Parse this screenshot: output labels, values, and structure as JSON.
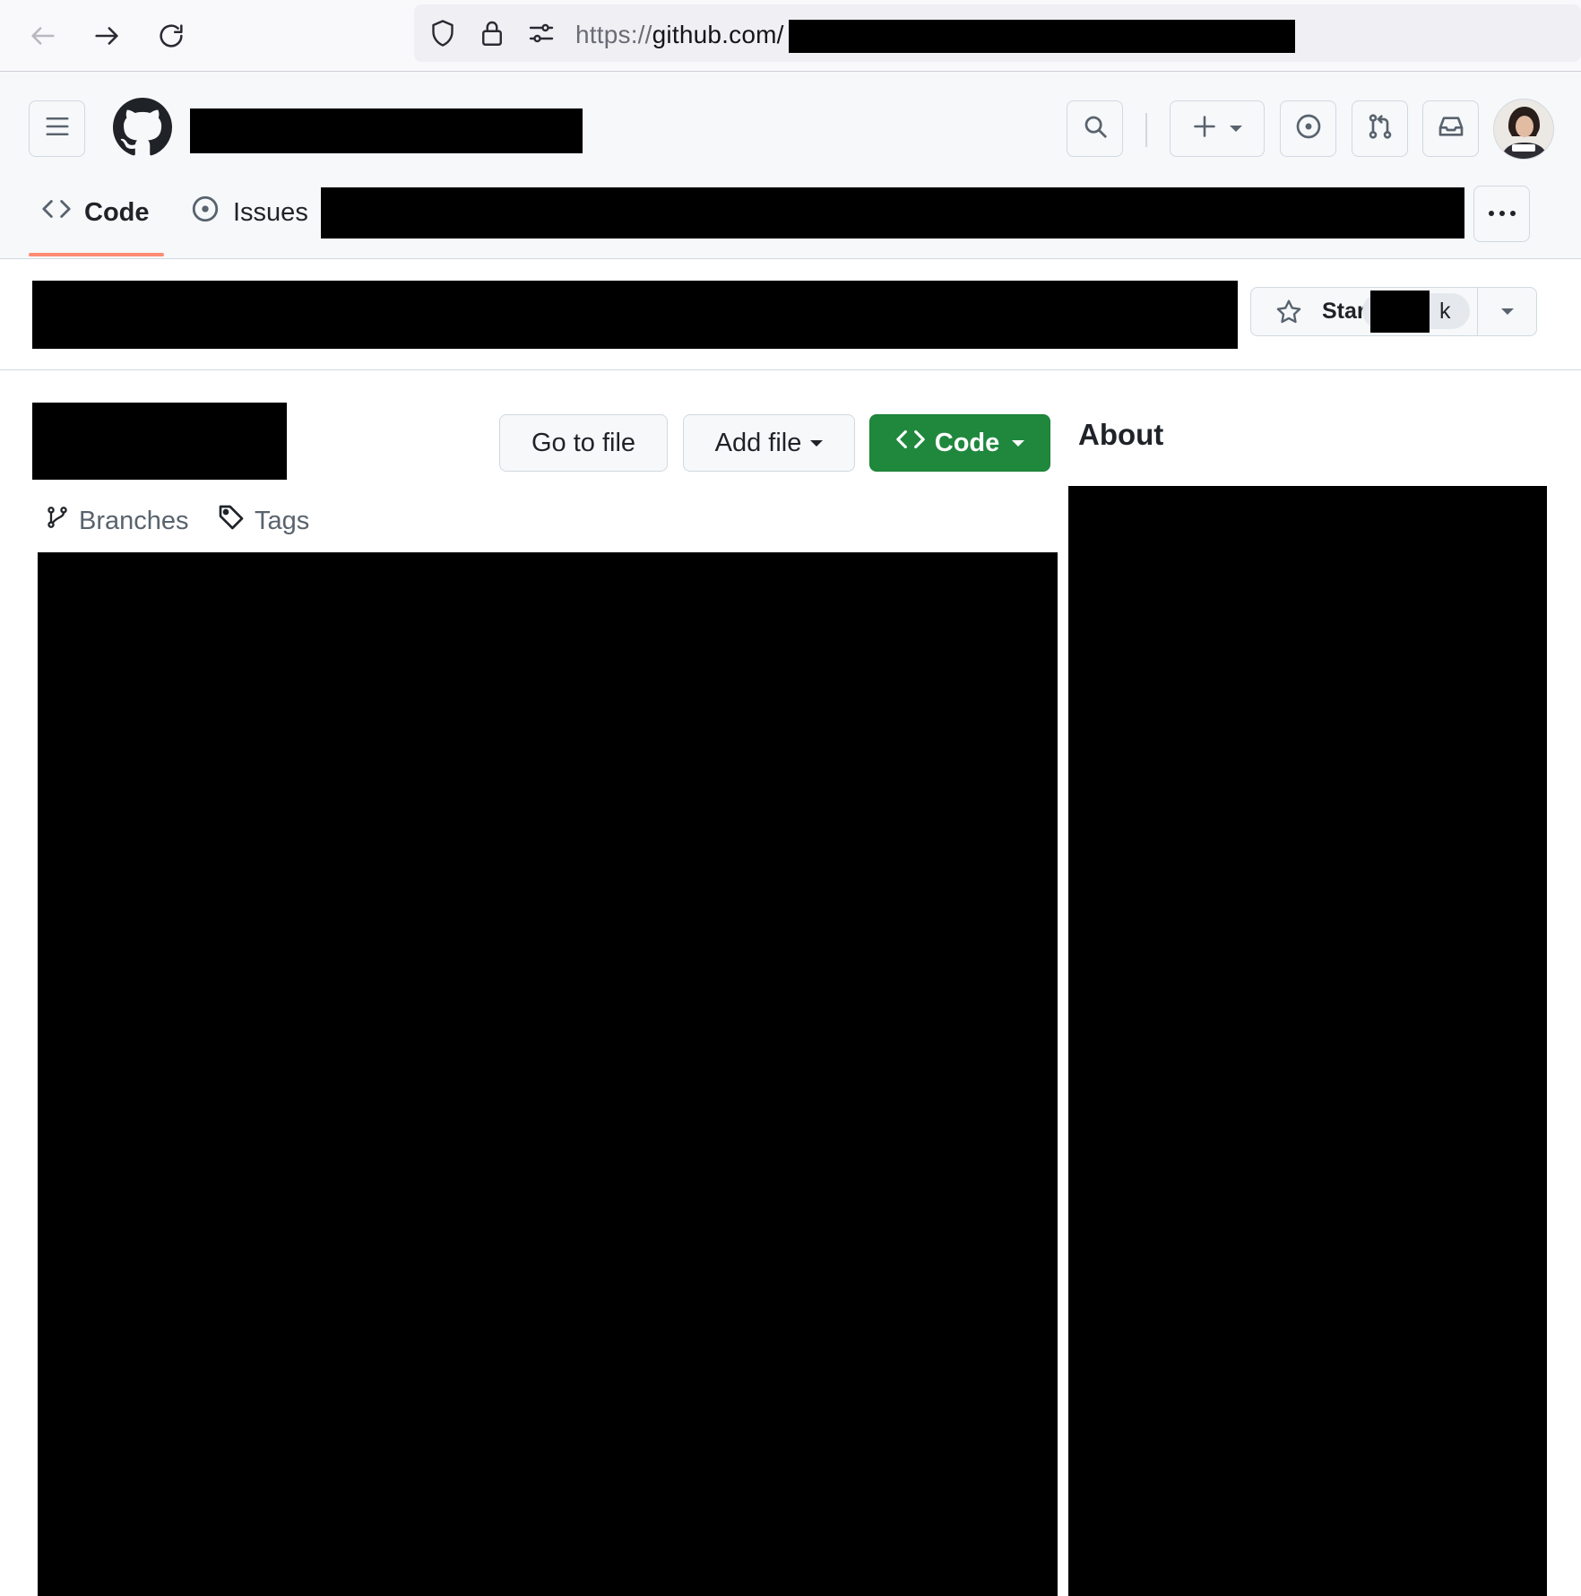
{
  "browser": {
    "url_scheme": "https://",
    "url_host": "github.com/",
    "icons": [
      "back-arrow-icon",
      "forward-arrow-icon",
      "reload-icon",
      "shield-icon",
      "lock-icon",
      "permissions-icon"
    ]
  },
  "header": {
    "icons": [
      "hamburger-icon",
      "github-logo",
      "search-icon",
      "plus-icon",
      "issues-icon",
      "pull-requests-icon",
      "inbox-icon",
      "avatar"
    ]
  },
  "tabs": [
    {
      "label": "Code",
      "icon": "code-icon",
      "selected": true
    },
    {
      "label": "Issues",
      "icon": "issue-opened-icon",
      "selected": false
    }
  ],
  "repo_actions": {
    "star_label": "Star",
    "star_count_suffix": "k"
  },
  "file_nav": {
    "go_to_file_label": "Go to file",
    "add_file_label": "Add file",
    "code_label": "Code",
    "branches_label": "Branches",
    "tags_label": "Tags"
  },
  "sidebar": {
    "about_heading": "About"
  },
  "colors": {
    "accent_underline": "#fd8c73",
    "primary_button": "#1f883d"
  }
}
